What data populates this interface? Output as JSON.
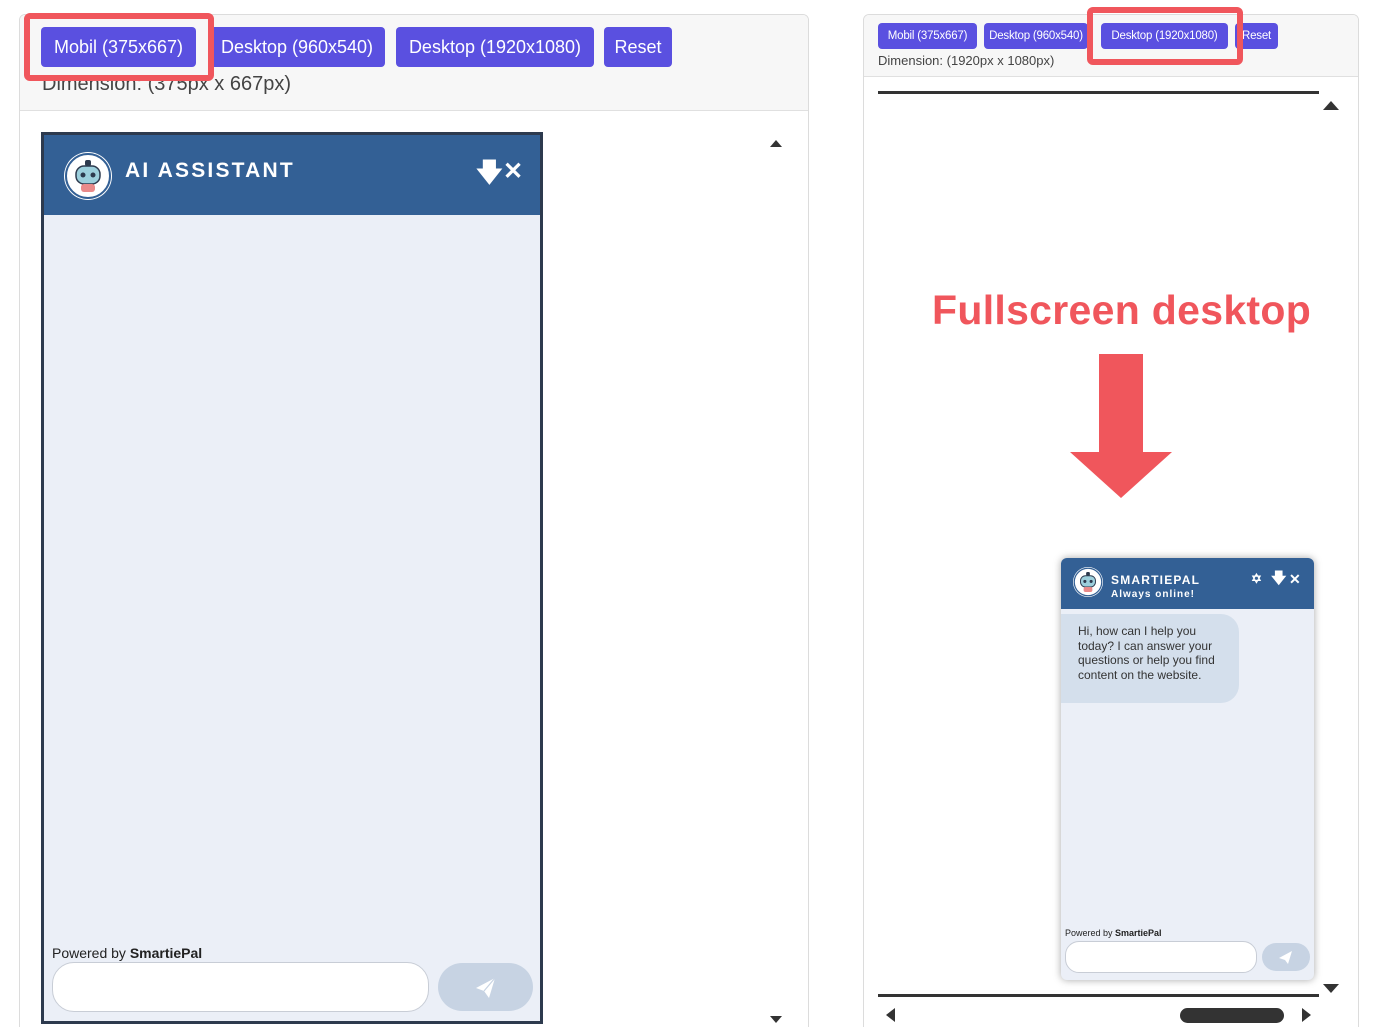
{
  "left_panel": {
    "buttons": {
      "mobile": "Mobil (375x667)",
      "desktop_960": "Desktop (960x540)",
      "desktop_1920": "Desktop (1920x1080)",
      "reset": "Reset"
    },
    "dimension_text": "Dimension: (375px x 667px)",
    "widget": {
      "title": "AI ASSISTANT",
      "powered_by_prefix": "Powered by ",
      "powered_by_brand": "SmartiePal",
      "input_value": "",
      "icons": [
        "robot-avatar-icon",
        "download-icon",
        "close-icon",
        "send-icon"
      ]
    }
  },
  "right_panel": {
    "buttons": {
      "mobile": "Mobil (375x667)",
      "desktop_960": "Desktop (960x540)",
      "desktop_1920": "Desktop (1920x1080)",
      "reset": "Reset"
    },
    "dimension_text": "Dimension: (1920px x 1080px)",
    "annotation": "Fullscreen desktop",
    "widget": {
      "title": "SMARTIEPAL",
      "status": "Always online!",
      "greeting": "Hi, how can I help you today? I can answer your questions or help you find content on the website.",
      "powered_by_prefix": "Powered by ",
      "powered_by_brand": "SmartiePal",
      "input_value": "",
      "icons": [
        "robot-avatar-icon",
        "maximize-icon",
        "download-icon",
        "close-icon",
        "send-icon"
      ]
    }
  },
  "colors": {
    "button_bg": "#5a50e0",
    "widget_header": "#336095",
    "widget_body": "#ebeff7",
    "highlight": "#f0565c",
    "send_button": "#c7d3e3"
  }
}
